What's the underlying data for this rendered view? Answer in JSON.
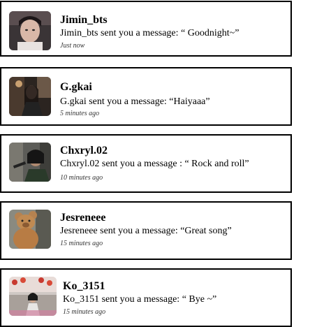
{
  "notifications": [
    {
      "username": "Jimin_bts",
      "message": "Jimin_bts sent you a message: “ Goodnight~”",
      "time": "Just now",
      "avatar": "jimin-avatar"
    },
    {
      "username": "G.gkai",
      "message": "G.gkai sent you a message: “Haiyaaa”",
      "time": "5 minutes ago",
      "avatar": "ggkai-avatar"
    },
    {
      "username": "Chxryl.02",
      "message": "Chxryl.02 sent you a message : “ Rock and roll”",
      "time": "10 minutes ago",
      "avatar": "chxryl-avatar"
    },
    {
      "username": "Jesreneee",
      "message": "Jesreneee sent you a message: “Great song”",
      "time": "15 minutes ago",
      "avatar": "jesreneee-avatar"
    },
    {
      "username": "Ko_3151",
      "message": "Ko_3151 sent you a message: “ Bye ~”",
      "time": "15 minutes ago",
      "avatar": "ko-avatar"
    }
  ]
}
